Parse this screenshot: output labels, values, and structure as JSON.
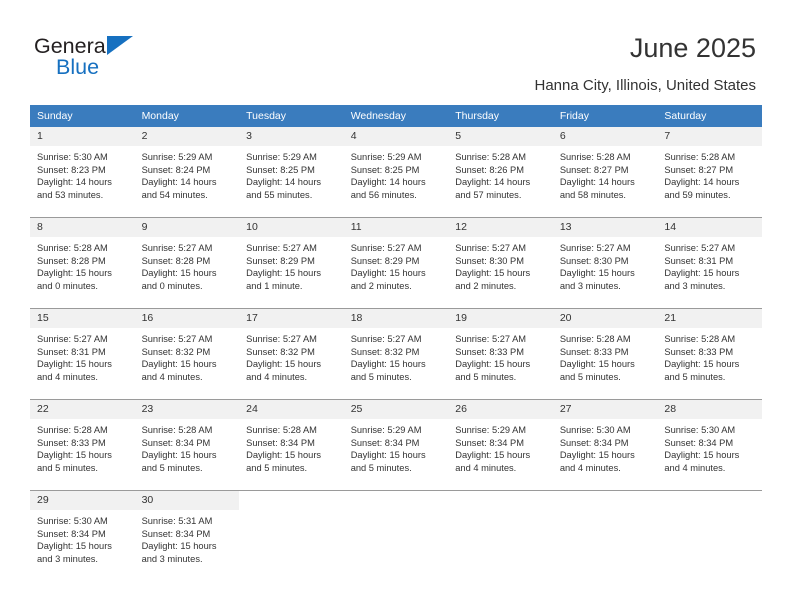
{
  "brand": {
    "name_top": "General",
    "name_bottom": "Blue",
    "accent_color": "#1670c0",
    "triangle_icon": "triangle-icon"
  },
  "header": {
    "title": "June 2025",
    "subtitle": "Hanna City, Illinois, United States"
  },
  "calendar": {
    "header_bg": "#3a7cbe",
    "daynum_bg": "#f1f1f1",
    "weekdays": [
      "Sunday",
      "Monday",
      "Tuesday",
      "Wednesday",
      "Thursday",
      "Friday",
      "Saturday"
    ],
    "weeks": [
      [
        {
          "day": "1",
          "sunrise": "Sunrise: 5:30 AM",
          "sunset": "Sunset: 8:23 PM",
          "daylight": "Daylight: 14 hours and 53 minutes."
        },
        {
          "day": "2",
          "sunrise": "Sunrise: 5:29 AM",
          "sunset": "Sunset: 8:24 PM",
          "daylight": "Daylight: 14 hours and 54 minutes."
        },
        {
          "day": "3",
          "sunrise": "Sunrise: 5:29 AM",
          "sunset": "Sunset: 8:25 PM",
          "daylight": "Daylight: 14 hours and 55 minutes."
        },
        {
          "day": "4",
          "sunrise": "Sunrise: 5:29 AM",
          "sunset": "Sunset: 8:25 PM",
          "daylight": "Daylight: 14 hours and 56 minutes."
        },
        {
          "day": "5",
          "sunrise": "Sunrise: 5:28 AM",
          "sunset": "Sunset: 8:26 PM",
          "daylight": "Daylight: 14 hours and 57 minutes."
        },
        {
          "day": "6",
          "sunrise": "Sunrise: 5:28 AM",
          "sunset": "Sunset: 8:27 PM",
          "daylight": "Daylight: 14 hours and 58 minutes."
        },
        {
          "day": "7",
          "sunrise": "Sunrise: 5:28 AM",
          "sunset": "Sunset: 8:27 PM",
          "daylight": "Daylight: 14 hours and 59 minutes."
        }
      ],
      [
        {
          "day": "8",
          "sunrise": "Sunrise: 5:28 AM",
          "sunset": "Sunset: 8:28 PM",
          "daylight": "Daylight: 15 hours and 0 minutes."
        },
        {
          "day": "9",
          "sunrise": "Sunrise: 5:27 AM",
          "sunset": "Sunset: 8:28 PM",
          "daylight": "Daylight: 15 hours and 0 minutes."
        },
        {
          "day": "10",
          "sunrise": "Sunrise: 5:27 AM",
          "sunset": "Sunset: 8:29 PM",
          "daylight": "Daylight: 15 hours and 1 minute."
        },
        {
          "day": "11",
          "sunrise": "Sunrise: 5:27 AM",
          "sunset": "Sunset: 8:29 PM",
          "daylight": "Daylight: 15 hours and 2 minutes."
        },
        {
          "day": "12",
          "sunrise": "Sunrise: 5:27 AM",
          "sunset": "Sunset: 8:30 PM",
          "daylight": "Daylight: 15 hours and 2 minutes."
        },
        {
          "day": "13",
          "sunrise": "Sunrise: 5:27 AM",
          "sunset": "Sunset: 8:30 PM",
          "daylight": "Daylight: 15 hours and 3 minutes."
        },
        {
          "day": "14",
          "sunrise": "Sunrise: 5:27 AM",
          "sunset": "Sunset: 8:31 PM",
          "daylight": "Daylight: 15 hours and 3 minutes."
        }
      ],
      [
        {
          "day": "15",
          "sunrise": "Sunrise: 5:27 AM",
          "sunset": "Sunset: 8:31 PM",
          "daylight": "Daylight: 15 hours and 4 minutes."
        },
        {
          "day": "16",
          "sunrise": "Sunrise: 5:27 AM",
          "sunset": "Sunset: 8:32 PM",
          "daylight": "Daylight: 15 hours and 4 minutes."
        },
        {
          "day": "17",
          "sunrise": "Sunrise: 5:27 AM",
          "sunset": "Sunset: 8:32 PM",
          "daylight": "Daylight: 15 hours and 4 minutes."
        },
        {
          "day": "18",
          "sunrise": "Sunrise: 5:27 AM",
          "sunset": "Sunset: 8:32 PM",
          "daylight": "Daylight: 15 hours and 5 minutes."
        },
        {
          "day": "19",
          "sunrise": "Sunrise: 5:27 AM",
          "sunset": "Sunset: 8:33 PM",
          "daylight": "Daylight: 15 hours and 5 minutes."
        },
        {
          "day": "20",
          "sunrise": "Sunrise: 5:28 AM",
          "sunset": "Sunset: 8:33 PM",
          "daylight": "Daylight: 15 hours and 5 minutes."
        },
        {
          "day": "21",
          "sunrise": "Sunrise: 5:28 AM",
          "sunset": "Sunset: 8:33 PM",
          "daylight": "Daylight: 15 hours and 5 minutes."
        }
      ],
      [
        {
          "day": "22",
          "sunrise": "Sunrise: 5:28 AM",
          "sunset": "Sunset: 8:33 PM",
          "daylight": "Daylight: 15 hours and 5 minutes."
        },
        {
          "day": "23",
          "sunrise": "Sunrise: 5:28 AM",
          "sunset": "Sunset: 8:34 PM",
          "daylight": "Daylight: 15 hours and 5 minutes."
        },
        {
          "day": "24",
          "sunrise": "Sunrise: 5:28 AM",
          "sunset": "Sunset: 8:34 PM",
          "daylight": "Daylight: 15 hours and 5 minutes."
        },
        {
          "day": "25",
          "sunrise": "Sunrise: 5:29 AM",
          "sunset": "Sunset: 8:34 PM",
          "daylight": "Daylight: 15 hours and 5 minutes."
        },
        {
          "day": "26",
          "sunrise": "Sunrise: 5:29 AM",
          "sunset": "Sunset: 8:34 PM",
          "daylight": "Daylight: 15 hours and 4 minutes."
        },
        {
          "day": "27",
          "sunrise": "Sunrise: 5:30 AM",
          "sunset": "Sunset: 8:34 PM",
          "daylight": "Daylight: 15 hours and 4 minutes."
        },
        {
          "day": "28",
          "sunrise": "Sunrise: 5:30 AM",
          "sunset": "Sunset: 8:34 PM",
          "daylight": "Daylight: 15 hours and 4 minutes."
        }
      ],
      [
        {
          "day": "29",
          "sunrise": "Sunrise: 5:30 AM",
          "sunset": "Sunset: 8:34 PM",
          "daylight": "Daylight: 15 hours and 3 minutes."
        },
        {
          "day": "30",
          "sunrise": "Sunrise: 5:31 AM",
          "sunset": "Sunset: 8:34 PM",
          "daylight": "Daylight: 15 hours and 3 minutes."
        },
        {
          "day": "",
          "sunrise": "",
          "sunset": "",
          "daylight": ""
        },
        {
          "day": "",
          "sunrise": "",
          "sunset": "",
          "daylight": ""
        },
        {
          "day": "",
          "sunrise": "",
          "sunset": "",
          "daylight": ""
        },
        {
          "day": "",
          "sunrise": "",
          "sunset": "",
          "daylight": ""
        },
        {
          "day": "",
          "sunrise": "",
          "sunset": "",
          "daylight": ""
        }
      ]
    ]
  }
}
